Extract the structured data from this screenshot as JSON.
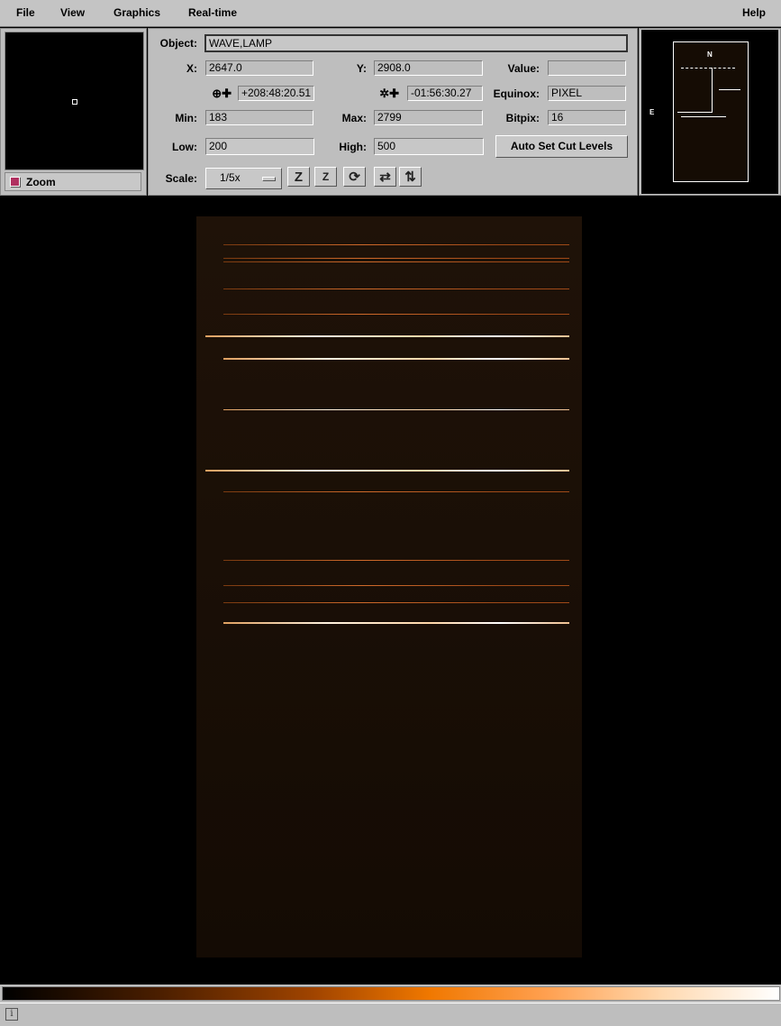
{
  "menu": {
    "file": "File",
    "view": "View",
    "graphics": "Graphics",
    "realtime": "Real-time",
    "help": "Help"
  },
  "zoom": {
    "label": "Zoom"
  },
  "info": {
    "object_label": "Object:",
    "object_value": "WAVE,LAMP",
    "x_label": "X:",
    "x_value": "2647.0",
    "y_label": "Y:",
    "y_value": "2908.0",
    "value_label": "Value:",
    "value_value": "",
    "ra_value": "+208:48:20.51",
    "dec_value": "-01:56:30.27",
    "equinox_label": "Equinox:",
    "equinox_value": "PIXEL",
    "min_label": "Min:",
    "min_value": "183",
    "max_label": "Max:",
    "max_value": "2799",
    "bitpix_label": "Bitpix:",
    "bitpix_value": "16",
    "low_label": "Low:",
    "low_value": "200",
    "high_label": "High:",
    "high_value": "500",
    "autoset_label": "Auto Set Cut Levels",
    "scale_label": "Scale:",
    "scale_value": "1/5x"
  },
  "pan": {
    "north": "N",
    "east": "E"
  },
  "status": {
    "info_icon": "i"
  }
}
